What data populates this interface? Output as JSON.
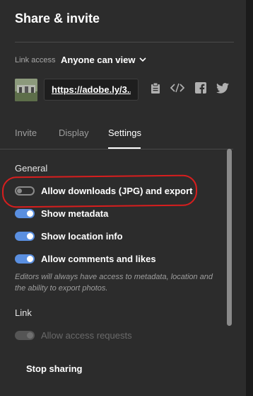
{
  "dialog": {
    "title": "Share & invite"
  },
  "link_access": {
    "label": "Link access",
    "value": "Anyone can view"
  },
  "link": {
    "url_text": "https://adobe.ly/3..."
  },
  "share_icons": [
    "clipboard-icon",
    "embed-code-icon",
    "facebook-icon",
    "twitter-icon"
  ],
  "tabs": [
    {
      "label": "Invite",
      "active": false
    },
    {
      "label": "Display",
      "active": false
    },
    {
      "label": "Settings",
      "active": true
    }
  ],
  "settings": {
    "general_heading": "General",
    "toggles": [
      {
        "label": "Allow downloads (JPG) and export",
        "state": "off"
      },
      {
        "label": "Show metadata",
        "state": "on"
      },
      {
        "label": "Show location info",
        "state": "on"
      },
      {
        "label": "Allow comments and likes",
        "state": "on"
      }
    ],
    "note": "Editors will always have access to metadata, location and the ability to export photos.",
    "link_heading": "Link",
    "link_toggle": {
      "label": "Allow access requests",
      "state": "disabled-on"
    }
  },
  "footer": {
    "stop_sharing": "Stop sharing"
  },
  "colors": {
    "background": "#2c2c2c",
    "toggle_on": "#5a8fe0",
    "annotation": "#d81e1e"
  }
}
